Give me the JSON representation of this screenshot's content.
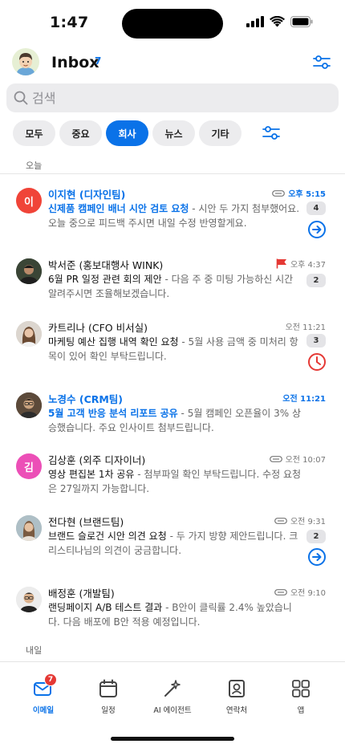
{
  "status_bar": {
    "time": "1:47"
  },
  "header": {
    "title": "Inbox",
    "unread_count": "7"
  },
  "search": {
    "placeholder": "검색"
  },
  "filters": [
    "모두",
    "중요",
    "회사",
    "뉴스",
    "기타"
  ],
  "active_filter": "회사",
  "sections": {
    "today": "오늘",
    "tomorrow": "내일"
  },
  "emails": [
    {
      "sender": "이지현 (디자인팀)",
      "time": "오후 5:15",
      "subject": "신제품 캠페인 배너 시안 검토 요청",
      "preview": " - 시안 두 가지 첨부했어요. 오늘 중으로 피드백 주시면 내일 수정 반영할게요.",
      "count": "4",
      "unread": true,
      "avatar_initial": "이",
      "avatar_color": "#f04438"
    },
    {
      "sender": "박서준 (홍보대행사 WINK)",
      "time": "오후 4:37",
      "subject": "6월 PR 일정 관련 회의 제안",
      "preview": " - 다음 주 중 미팅 가능하신 시간 알려주시면 조율해보겠습니다.",
      "count": "2",
      "unread": false
    },
    {
      "sender": "카트리나 (CFO 비서실)",
      "time": "오전 11:21",
      "subject": "마케팅 예산 집행 내역 확인 요청",
      "preview": " - 5월 사용 금액 중 미처리 항목이 있어 확인 부탁드립니다.",
      "count": "3",
      "unread": false
    },
    {
      "sender": "노경수 (CRM팀)",
      "time": "오전 11:21",
      "subject": "5월 고객 반응 분석 리포트 공유",
      "preview": " - 5월 캠페인 오픈율이 3% 상승했습니다. 주요 인사이트 첨부드립니다.",
      "unread": true
    },
    {
      "sender": "김상훈 (외주 디자이너)",
      "time": "오전 10:07",
      "subject": "영상 편집본 1차 공유",
      "preview": " - 첨부파일 확인 부탁드립니다. 수정 요청은 27일까지 가능합니다.",
      "unread": false,
      "avatar_initial": "김",
      "avatar_color": "#ec4fb7"
    },
    {
      "sender": "전다현 (브랜드팀)",
      "time": "오전 9:31",
      "subject": "브랜드 슬로건 시안 의견 요청",
      "preview": " - 두 가지 방향 제안드립니다. 크리스티나님의 의견이 궁금합니다.",
      "count": "2",
      "unread": false
    },
    {
      "sender": "배정훈 (개발팀)",
      "time": "오전 9:10",
      "subject": "랜딩페이지 A/B 테스트 결과",
      "preview": " - B안이 클릭률 2.4% 높았습니다. 다음 배포에 B안 적용 예정입니다.",
      "unread": false
    }
  ],
  "tabbar": {
    "items": [
      "이메일",
      "일정",
      "AI 에이전트",
      "연락처",
      "앱"
    ],
    "badge": "7"
  },
  "colors": {
    "accent": "#0a72e8",
    "flag": "#e53935",
    "reminder": "#e53935"
  }
}
